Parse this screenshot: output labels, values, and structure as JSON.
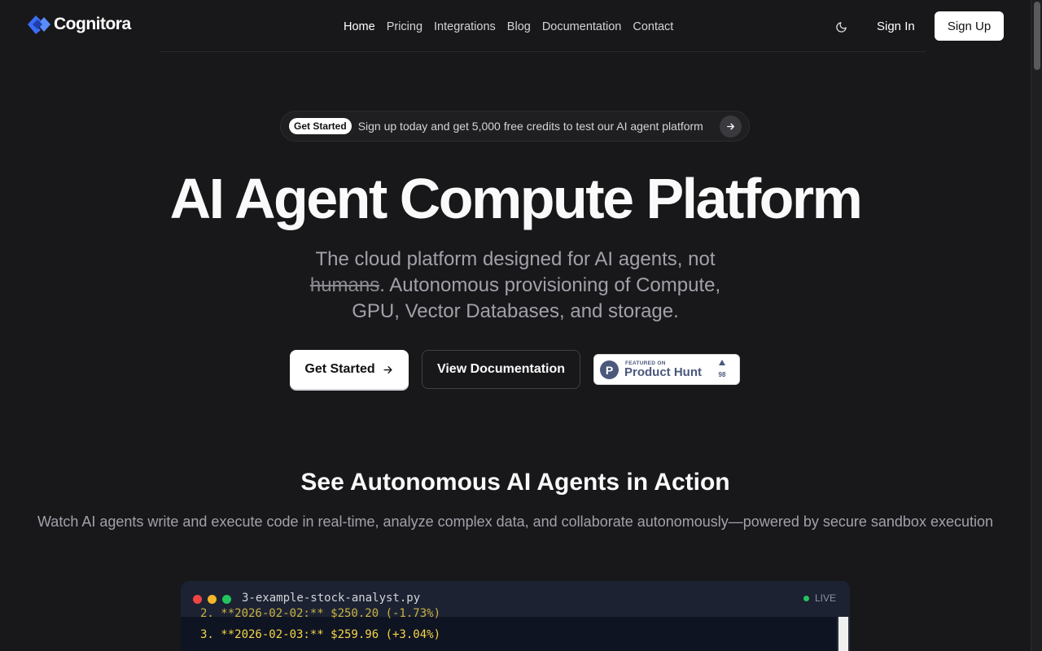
{
  "brand": {
    "name": "Cognitora"
  },
  "nav": {
    "items": [
      {
        "label": "Home",
        "active": true
      },
      {
        "label": "Pricing"
      },
      {
        "label": "Integrations"
      },
      {
        "label": "Blog"
      },
      {
        "label": "Documentation"
      },
      {
        "label": "Contact"
      }
    ],
    "theme_icon": "moon-icon",
    "signin": "Sign In",
    "signup": "Sign Up"
  },
  "announcement": {
    "badge": "Get Started",
    "text": "Sign up today and get 5,000 free credits to test our AI agent platform",
    "arrow_icon": "arrow-right-icon"
  },
  "hero": {
    "title": "AI Agent Compute Platform",
    "sub_part1": "The cloud platform designed for AI agents, not ",
    "sub_strike": "humans",
    "sub_part2": ". Autonomous provisioning of Compute, GPU, Vector Databases, and storage.",
    "cta_primary": "Get Started",
    "cta_secondary": "View Documentation"
  },
  "product_hunt": {
    "featured": "FEATURED ON",
    "name": "Product Hunt",
    "logo_letter": "P",
    "count": "98"
  },
  "section": {
    "title": "See Autonomous AI Agents in Action",
    "subtitle": "Watch AI agents write and execute code in real-time, analyze complex data, and collaborate autonomously—powered by secure sandbox execution"
  },
  "terminal": {
    "filename": "3-example-stock-analyst.py",
    "status": "LIVE",
    "prev_line": "2. **2026-02-02:** $250.20 (-1.73%)",
    "current_line": "3. **2026-02-03:** $259.96 (+3.04%)"
  },
  "colors": {
    "background": "#18181a",
    "brand_blue": "#3b6cf6",
    "terminal_text": "#f5d547",
    "live_green": "#22c55e"
  }
}
